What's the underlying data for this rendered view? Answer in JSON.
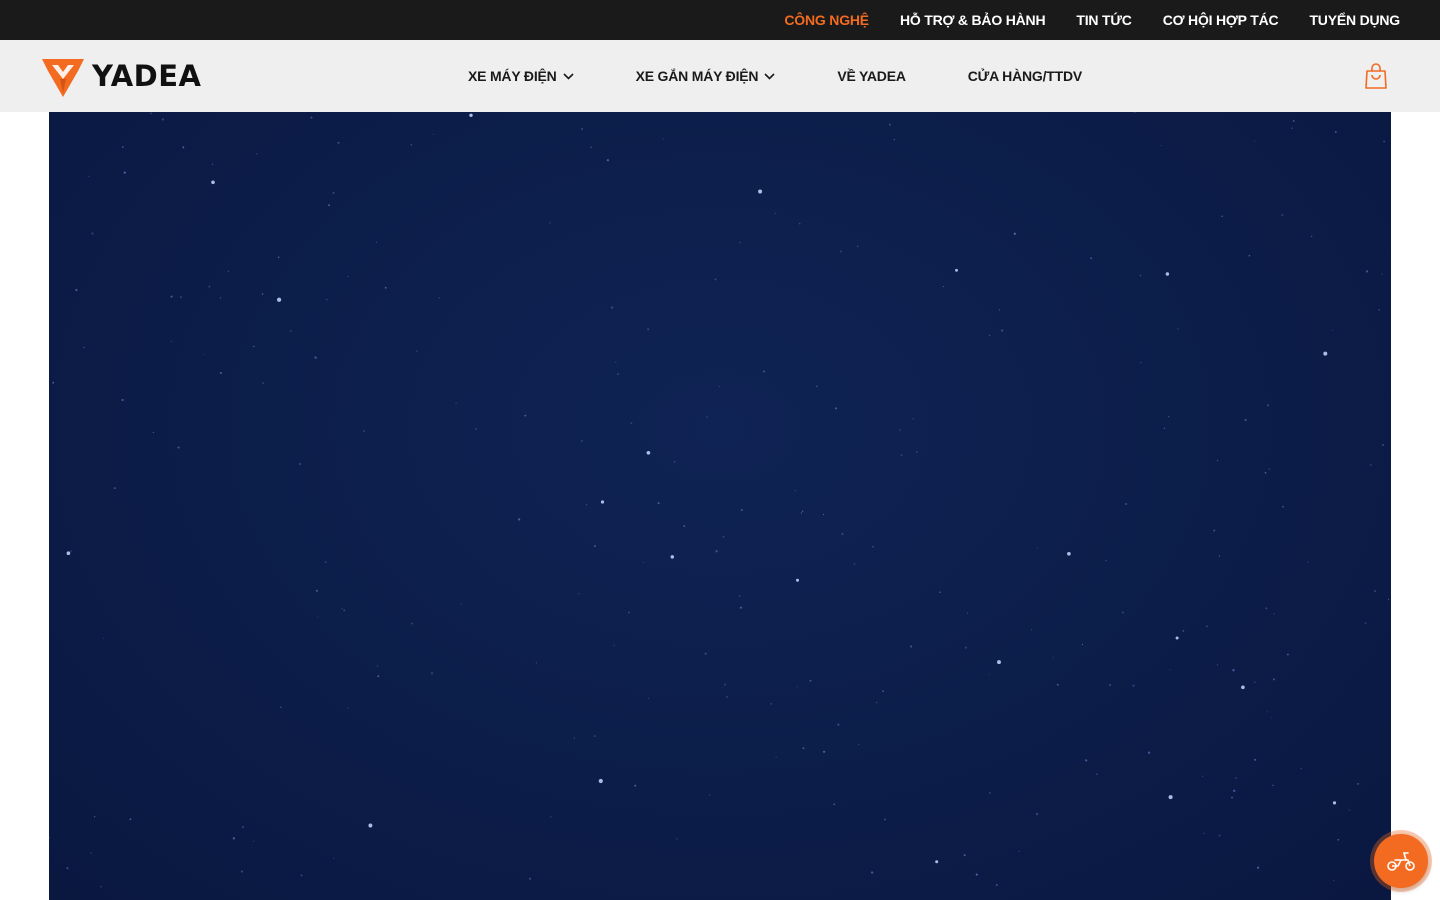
{
  "top_menu": {
    "items": [
      {
        "label": "CÔNG NGHỆ",
        "active": true
      },
      {
        "label": "HỖ TRỢ & BẢO HÀNH",
        "active": false
      },
      {
        "label": "TIN TỨC",
        "active": false
      },
      {
        "label": "CƠ HỘI HỢP TÁC",
        "active": false
      },
      {
        "label": "TUYỂN DỤNG",
        "active": false
      }
    ]
  },
  "header": {
    "logo_text": "YADEA",
    "nav": [
      {
        "label": "XE MÁY ĐIỆN",
        "has_dropdown": true
      },
      {
        "label": "XE GẮN MÁY ĐIỆN",
        "has_dropdown": true
      },
      {
        "label": "VỀ YADEA",
        "has_dropdown": false
      },
      {
        "label": "CỬA HÀNG/TTDV",
        "has_dropdown": false
      }
    ],
    "cart_icon": "shopping-bag-icon"
  },
  "hero": {
    "background": "starry-night-sky",
    "color": "#0c1d49"
  },
  "floating_button": {
    "icon": "scooter-icon",
    "color": "#f26b21"
  },
  "colors": {
    "accent": "#f26b21",
    "topbar_bg": "#1a1a1a",
    "nav_bg": "#efefef"
  }
}
